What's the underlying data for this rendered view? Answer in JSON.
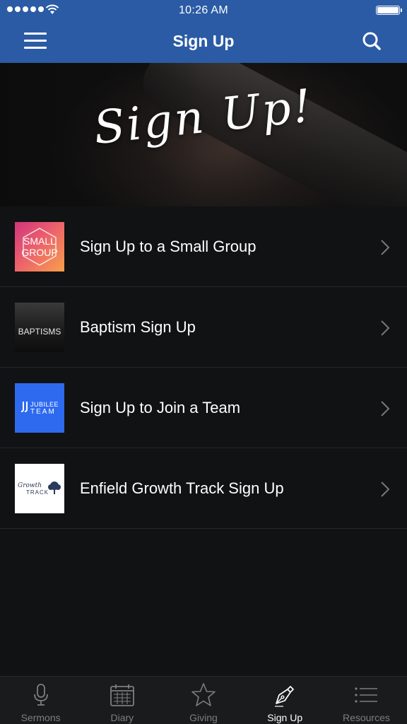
{
  "status_bar": {
    "time": "10:26 AM"
  },
  "nav": {
    "title": "Sign Up",
    "menu_icon": "hamburger-menu-icon",
    "search_icon": "search-icon"
  },
  "hero": {
    "title": "Sign Up!"
  },
  "items": [
    {
      "label": "Sign Up to a Small Group",
      "thumb_text": [
        "SMALL",
        "GROUP"
      ]
    },
    {
      "label": "Baptism Sign Up",
      "thumb_text": "BAPTISMS"
    },
    {
      "label": "Sign Up to Join a Team",
      "thumb_text": [
        "JUBILEE",
        "TEAM"
      ]
    },
    {
      "label": "Enfield Growth Track Sign Up",
      "thumb_text": [
        "Growth",
        "TRACK"
      ]
    }
  ],
  "tabs": [
    {
      "label": "Sermons",
      "icon": "microphone-icon",
      "active": false
    },
    {
      "label": "Diary",
      "icon": "calendar-icon",
      "active": false
    },
    {
      "label": "Giving",
      "icon": "star-icon",
      "active": false
    },
    {
      "label": "Sign Up",
      "icon": "pen-nib-icon",
      "active": true
    },
    {
      "label": "Resources",
      "icon": "list-icon",
      "active": false
    }
  ],
  "colors": {
    "nav_bar": "#2b5ba5",
    "background": "#111213",
    "tab_bar": "#1a1b1c",
    "tab_inactive": "#7d7e80",
    "tab_active": "#ffffff"
  }
}
